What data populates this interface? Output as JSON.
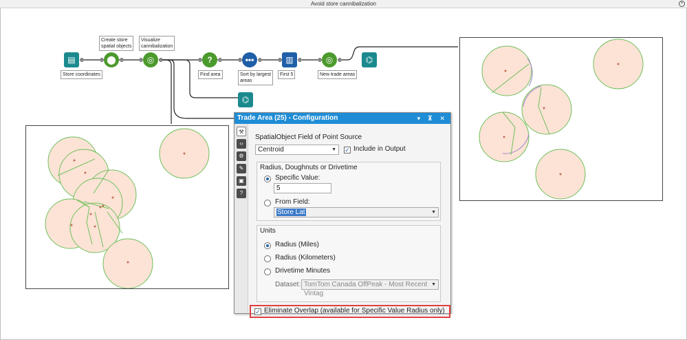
{
  "window": {
    "title": "Avoid store cannibalization"
  },
  "tools": {
    "store_coordinates": "Store coordinates",
    "create_store": "Create store\nspatial objects",
    "visualize": "Visualize\ncannibalization",
    "find_area": "Find area",
    "sort_largest": "Sort by largest\nareas",
    "first5": "First 5",
    "new_trade": "New trade areas"
  },
  "panel": {
    "title": "Trade Area (25) - Configuration",
    "controls": "▾ ⊼ ✕",
    "spatial_label": "SpatialObject Field of Point Source",
    "spatial_value": "Centroid",
    "include_output": "Include in Output",
    "radius_group": "Radius, Doughnuts or Drivetime",
    "specific_value_label": "Specific Value:",
    "specific_value": "5",
    "from_field_label": "From Field:",
    "from_field_value": "Store Lat",
    "units_group": "Units",
    "radius_miles": "Radius (Miles)",
    "radius_km": "Radius (Kilometers)",
    "drivetime": "Drivetime Minutes",
    "dataset_label": "Dataset:",
    "dataset_value": "TomTom Canada OffPeak - Most Recent Vintag",
    "eliminate_overlap": "Eliminate Overlap (available for Specific Value Radius only)"
  },
  "colors": {
    "accent": "#1f8dd6",
    "circle_fill": "#fce3d6",
    "circle_stroke": "#6fbf5a",
    "highlight": "#e04040"
  }
}
